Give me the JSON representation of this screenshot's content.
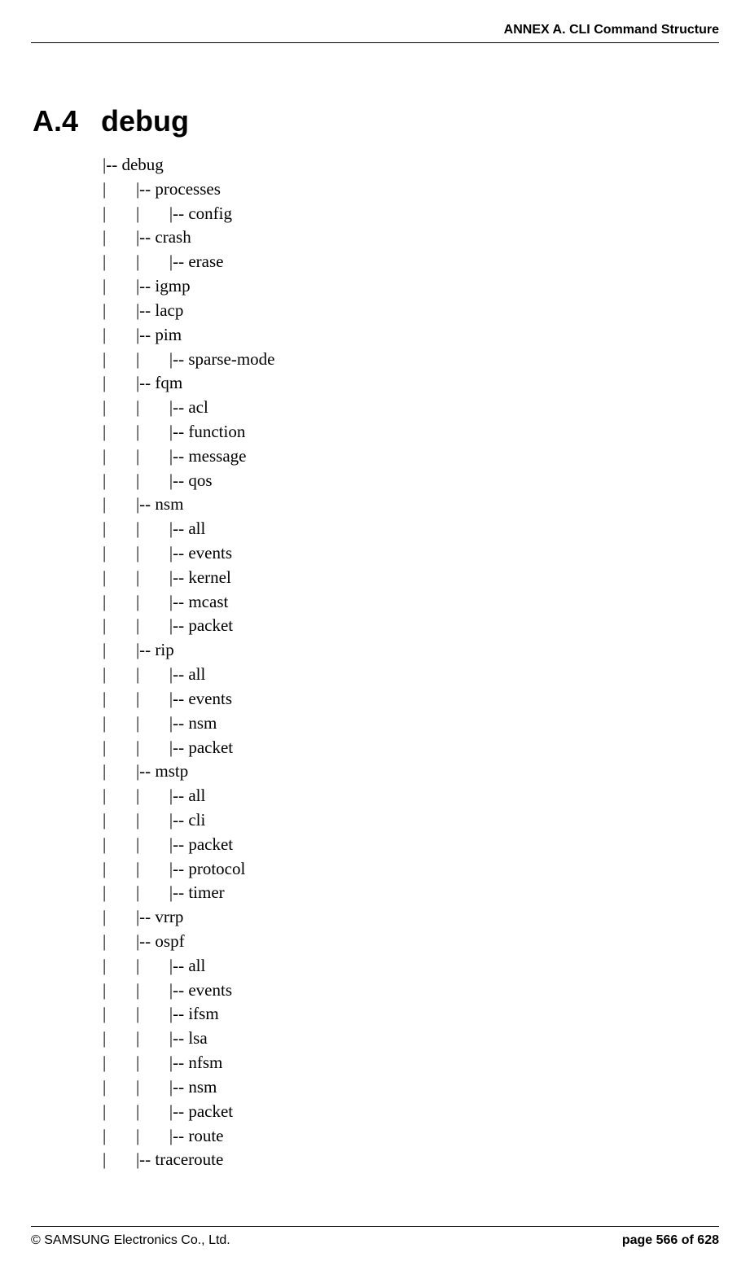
{
  "header": {
    "annex_title": "ANNEX A. CLI Command Structure"
  },
  "section": {
    "number": "A.4",
    "title": "debug"
  },
  "tree_lines": [
    "|-- debug",
    "|       |-- processes",
    "|       |       |-- config",
    "|       |-- crash",
    "|       |       |-- erase",
    "|       |-- igmp",
    "|       |-- lacp",
    "|       |-- pim",
    "|       |       |-- sparse-mode",
    "|       |-- fqm",
    "|       |       |-- acl",
    "|       |       |-- function",
    "|       |       |-- message",
    "|       |       |-- qos",
    "|       |-- nsm",
    "|       |       |-- all",
    "|       |       |-- events",
    "|       |       |-- kernel",
    "|       |       |-- mcast",
    "|       |       |-- packet",
    "|       |-- rip",
    "|       |       |-- all",
    "|       |       |-- events",
    "|       |       |-- nsm",
    "|       |       |-- packet",
    "|       |-- mstp",
    "|       |       |-- all",
    "|       |       |-- cli",
    "|       |       |-- packet",
    "|       |       |-- protocol",
    "|       |       |-- timer",
    "|       |-- vrrp",
    "|       |-- ospf",
    "|       |       |-- all",
    "|       |       |-- events",
    "|       |       |-- ifsm",
    "|       |       |-- lsa",
    "|       |       |-- nfsm",
    "|       |       |-- nsm",
    "|       |       |-- packet",
    "|       |       |-- route",
    "|       |-- traceroute"
  ],
  "footer": {
    "copyright": "© SAMSUNG Electronics Co., Ltd.",
    "page_info": "page 566 of 628"
  }
}
